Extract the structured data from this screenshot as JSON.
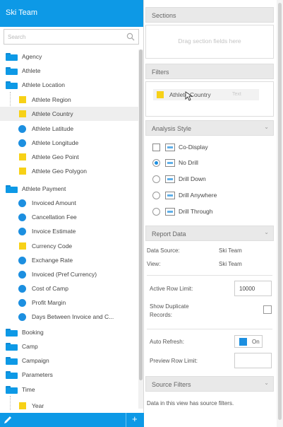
{
  "left_panel": {
    "title": "Ski Team",
    "search_placeholder": "Search",
    "tree": [
      {
        "type": "folder",
        "label": "Agency"
      },
      {
        "type": "folder",
        "label": "Athlete"
      },
      {
        "type": "folder",
        "label": "Athlete Location"
      },
      {
        "type": "dimension",
        "label": "Athlete Region"
      },
      {
        "type": "dimension",
        "label": "Athlete Country",
        "selected": true
      },
      {
        "type": "metric",
        "label": "Athlete Latitude"
      },
      {
        "type": "metric",
        "label": "Athlete Longitude"
      },
      {
        "type": "dimension",
        "label": "Athlete Geo Point"
      },
      {
        "type": "dimension",
        "label": "Athlete Geo Polygon"
      },
      {
        "type": "folder",
        "label": "Athlete Payment"
      },
      {
        "type": "metric",
        "label": "Invoiced Amount"
      },
      {
        "type": "metric",
        "label": "Cancellation Fee"
      },
      {
        "type": "metric",
        "label": "Invoice Estimate"
      },
      {
        "type": "dimension",
        "label": "Currency Code"
      },
      {
        "type": "metric",
        "label": "Exchange Rate"
      },
      {
        "type": "metric",
        "label": "Invoiced (Pref Currency)"
      },
      {
        "type": "metric",
        "label": "Cost of Camp"
      },
      {
        "type": "metric",
        "label": "Profit Margin"
      },
      {
        "type": "metric",
        "label": "Days Between Invoice and C..."
      },
      {
        "type": "folder",
        "label": "Booking"
      },
      {
        "type": "folder",
        "label": "Camp"
      },
      {
        "type": "folder",
        "label": "Campaign"
      },
      {
        "type": "folder",
        "label": "Parameters"
      },
      {
        "type": "folder",
        "label": "Time"
      },
      {
        "type": "dimension",
        "label": "Year"
      }
    ],
    "footer": {
      "add_label": "+"
    }
  },
  "right_panel": {
    "sections": {
      "title": "Sections",
      "hint": "Drag section fields here"
    },
    "filters": {
      "title": "Filters",
      "chip_label": "Athlete Country",
      "chip_ghost": "Text"
    },
    "analysis_style": {
      "title": "Analysis Style",
      "options": [
        {
          "kind": "checkbox",
          "label": "Co-Display",
          "checked": false
        },
        {
          "kind": "radio",
          "label": "No Drill",
          "checked": true
        },
        {
          "kind": "radio",
          "label": "Drill Down",
          "checked": false
        },
        {
          "kind": "radio",
          "label": "Drill Anywhere",
          "checked": false
        },
        {
          "kind": "radio",
          "label": "Drill Through",
          "checked": false
        }
      ]
    },
    "report_data": {
      "title": "Report Data",
      "data_source_label": "Data Source:",
      "data_source_value": "Ski Team",
      "view_label": "View:",
      "view_value": "Ski Team",
      "active_row_limit_label": "Active Row Limit:",
      "active_row_limit_value": "10000",
      "show_duplicate_label_1": "Show Duplicate",
      "show_duplicate_label_2": "Records:",
      "auto_refresh_label": "Auto Refresh:",
      "auto_refresh_value": "On",
      "preview_row_limit_label": "Preview Row Limit:",
      "preview_row_limit_value": ""
    },
    "source_filters": {
      "title": "Source Filters",
      "text": "Data in this view has source filters."
    }
  },
  "colors": {
    "accent": "#0d99e6",
    "dimension": "#f7d117",
    "metric": "#1c8fe0"
  }
}
